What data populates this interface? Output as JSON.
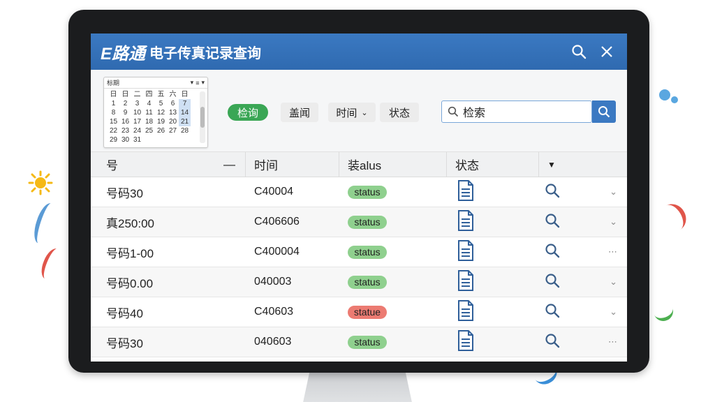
{
  "window": {
    "brand": "E路通",
    "title": "电子传真记录查询"
  },
  "calendar": {
    "header_label": "标期",
    "days": [
      "日",
      "日",
      "二",
      "四",
      "五",
      "六",
      "日",
      "1",
      "2",
      "3",
      "4",
      "5",
      "6",
      "7",
      "8",
      "9",
      "10",
      "11",
      "12",
      "13",
      "14",
      "15",
      "16",
      "17",
      "18",
      "19",
      "20",
      "21",
      "22",
      "23",
      "24",
      "25",
      "26",
      "27",
      "28",
      "29",
      "30",
      "31"
    ]
  },
  "toolbar": {
    "query_label": "检询",
    "filter_a_label": "盖闻",
    "filter_b_label": "时间",
    "filter_c_label": "状态"
  },
  "search": {
    "placeholder": "检索"
  },
  "table": {
    "headers": [
      "号",
      "时间",
      "装alus",
      "状态"
    ],
    "rows": [
      {
        "number": "号码30",
        "time": "C40004",
        "status": "status",
        "status_color": "green"
      },
      {
        "number": "真250:00",
        "time": "C406606",
        "status": "status",
        "status_color": "green"
      },
      {
        "number": "号码1-00",
        "time": "C400004",
        "status": "status",
        "status_color": "green"
      },
      {
        "number": "号码0.00",
        "time": "040003",
        "status": "status",
        "status_color": "green"
      },
      {
        "number": "号码40",
        "time": "C40603",
        "status": "statue",
        "status_color": "red"
      },
      {
        "number": "号码30",
        "time": "040603",
        "status": "status",
        "status_color": "green"
      }
    ]
  },
  "colors": {
    "titlebar": "#2f6ab0",
    "status_ok": "#8fd08e",
    "status_error": "#ec7b72",
    "query_button": "#3aa655"
  }
}
